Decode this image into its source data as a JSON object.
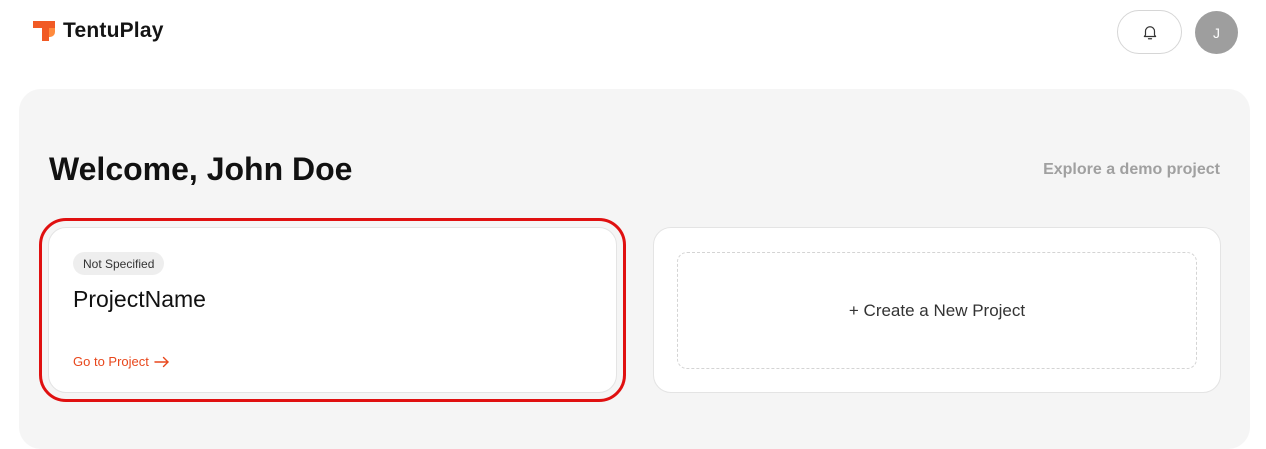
{
  "header": {
    "brand": "TentuPlay",
    "avatar_initial": "J",
    "icons": {
      "logo": "tentuplay-logo-icon",
      "bell": "bell-icon"
    }
  },
  "main": {
    "welcome_text": "Welcome, John Doe",
    "demo_link": "Explore a demo project",
    "project_card": {
      "badge": "Not Specified",
      "name": "ProjectName",
      "goto_label": "Go to Project"
    },
    "new_project_label": "+ Create a New Project"
  },
  "colors": {
    "brand_orange": "#f15a24",
    "link_orange": "#e8471c",
    "highlight_red": "#e01010",
    "panel_bg": "#f5f5f5",
    "avatar_bg": "#9e9e9e"
  }
}
